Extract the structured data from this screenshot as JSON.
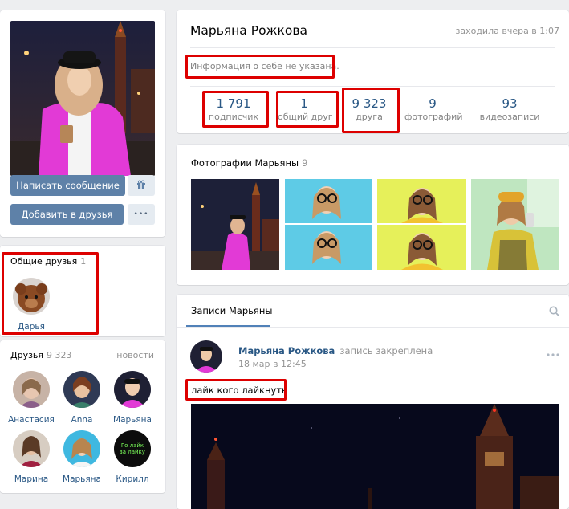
{
  "profile": {
    "name": "Марьяна Рожкова",
    "last_seen": "заходила вчера в 1:07",
    "info": "Информация о себе не указана."
  },
  "actions": {
    "message": "Написать сообщение",
    "add_friend": "Добавить в друзья",
    "more": "•••"
  },
  "counters": [
    {
      "num": "1 791",
      "label": "подписчик"
    },
    {
      "num": "1",
      "label": "общий друг"
    },
    {
      "num": "9 323",
      "label": "друга"
    },
    {
      "num": "9",
      "label": "фотографий"
    },
    {
      "num": "93",
      "label": "видеозаписи"
    }
  ],
  "common_friends": {
    "title": "Общие друзья",
    "count": "1",
    "items": [
      {
        "name": "Дарья"
      }
    ]
  },
  "friends": {
    "title": "Друзья",
    "count": "9 323",
    "news_link": "новости",
    "items": [
      {
        "name": "Анастасия"
      },
      {
        "name": "Anna"
      },
      {
        "name": "Марьяна"
      },
      {
        "name": "Марина"
      },
      {
        "name": "Марьяна"
      },
      {
        "name": "Кирилл"
      }
    ],
    "kirill_avatar_text": "Го лайк за лайку"
  },
  "photos": {
    "title": "Фотографии Марьяны",
    "count": "9"
  },
  "wall": {
    "tab": "Записи Марьяны",
    "post": {
      "author": "Марьяна Рожкова",
      "pinned": "запись закреплена",
      "date": "18 мар в 12:45",
      "text": "лайк кого лайкнуть"
    }
  },
  "icons": {
    "gift": "gift-icon",
    "search": "search-icon",
    "more": "more-dots-icon"
  },
  "colors": {
    "accent": "#5e81a8",
    "link": "#2a5885",
    "highlight": "#dd0000"
  }
}
